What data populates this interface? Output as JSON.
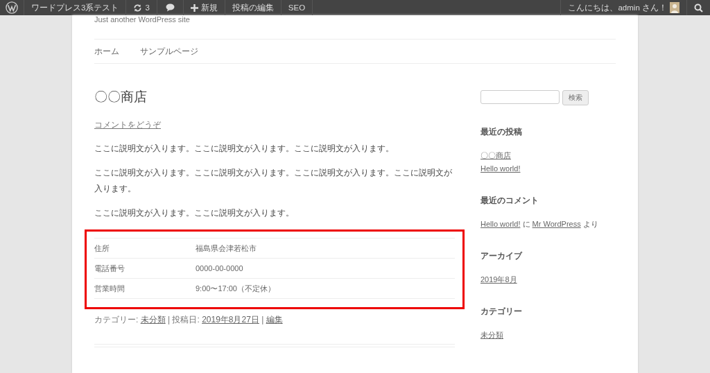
{
  "admin_bar": {
    "items": [
      {
        "kind": "logo"
      },
      {
        "kind": "text",
        "label": "ワードプレス3系テスト"
      },
      {
        "kind": "updates",
        "label": "3"
      },
      {
        "kind": "comments"
      },
      {
        "kind": "new",
        "label": "新規"
      },
      {
        "kind": "text",
        "label": "投稿の編集"
      },
      {
        "kind": "text",
        "label": "SEO"
      }
    ],
    "greeting": "こんにちは、admin さん！"
  },
  "site": {
    "tagline": "Just another WordPress site",
    "nav": [
      {
        "label": "ホーム"
      },
      {
        "label": "サンプルページ"
      }
    ]
  },
  "post": {
    "title": "〇〇商店",
    "comment_link": "コメントをどうぞ",
    "paragraphs": [
      "ここに説明文が入ります。ここに説明文が入ります。ここに説明文が入ります。",
      "ここに説明文が入ります。ここに説明文が入ります。ここに説明文が入ります。ここに説明文が入ります。",
      "ここに説明文が入ります。ここに説明文が入ります。"
    ],
    "details": {
      "highlighted": true,
      "rows": [
        {
          "label": "住所",
          "value": "福島県会津若松市"
        },
        {
          "label": "電話番号",
          "value": "0000-00-0000"
        },
        {
          "label": "営業時間",
          "value": "9:00〜17:00（不定休）"
        }
      ]
    },
    "meta": [
      {
        "text": "カテゴリー: ",
        "link": false
      },
      {
        "text": "未分類",
        "link": true
      },
      {
        "text": " | 投稿日: ",
        "link": false
      },
      {
        "text": "2019年8月27日",
        "link": true
      },
      {
        "text": " | ",
        "link": false
      },
      {
        "text": "編集",
        "link": true
      }
    ]
  },
  "sidebar": {
    "search_button": "検索",
    "widgets": [
      {
        "kind": "links",
        "title": "最近の投稿",
        "items": [
          "〇〇商店",
          "Hello world!"
        ]
      },
      {
        "kind": "comment",
        "title": "最近のコメント",
        "segments": [
          {
            "text": "Hello world!",
            "link": true
          },
          {
            "text": " に ",
            "link": false
          },
          {
            "text": "Mr WordPress",
            "link": true
          },
          {
            "text": " より",
            "link": false
          }
        ]
      },
      {
        "kind": "links",
        "title": "アーカイブ",
        "items": [
          "2019年8月"
        ]
      },
      {
        "kind": "links",
        "title": "カテゴリー",
        "items": [
          "未分類"
        ]
      }
    ]
  }
}
